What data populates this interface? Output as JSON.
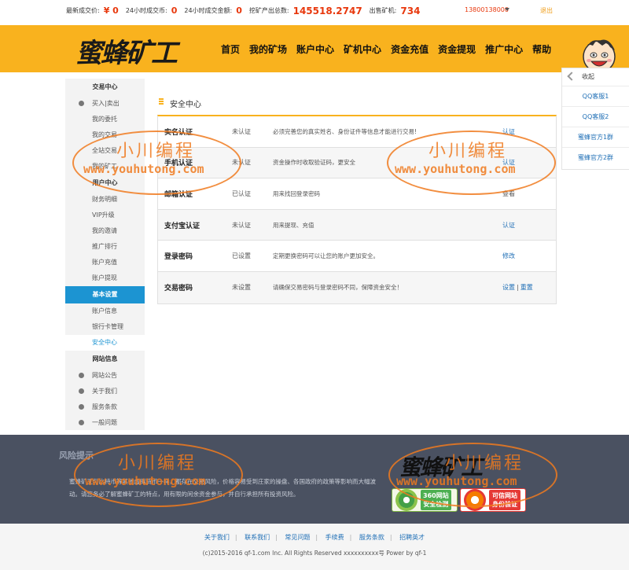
{
  "topbar": {
    "latest_price_label": "最新成交价:",
    "latest_price_value": "¥ 0",
    "vol24_label": "24小时成交币:",
    "vol24_value": "0",
    "amount24_label": "24小时成交金额:",
    "amount24_value": "0",
    "mined_label": "挖矿产出总数:",
    "mined_value": "145518.2747",
    "miners_label": "出售矿机:",
    "miners_value": "734",
    "user": "13800138000",
    "logout": "退出"
  },
  "header": {
    "logo_text": "蜜蜂矿工",
    "nav": [
      "首页",
      "我的矿场",
      "账户中心",
      "矿机中心",
      "资金充值",
      "资金提现",
      "推广中心",
      "帮助"
    ]
  },
  "float_panel": {
    "collapse": "收起",
    "items": [
      "QQ客服1",
      "QQ客服2",
      "蜜蜂官方1群",
      "蜜蜂官方2群"
    ]
  },
  "sidebar": {
    "trade_title": "交易中心",
    "trade_items": [
      "买入|卖出",
      "我的委托",
      "我的交易",
      "全站交易",
      "我的矿工"
    ],
    "user_title": "用户中心",
    "user_items": [
      "财务明细",
      "VIP升级",
      "我的邀请",
      "推广排行",
      "账户充值",
      "账户提现"
    ],
    "basic_title": "基本设置",
    "basic_items": [
      "账户信息",
      "银行卡管理",
      "安全中心"
    ],
    "site_title": "网站信息",
    "site_items": [
      "网站公告",
      "关于我们",
      "服务条款",
      "一般问题"
    ]
  },
  "main": {
    "title": "安全中心",
    "rows": [
      {
        "name": "实名认证",
        "status": "未认证",
        "desc": "必须完善您的真实姓名、身份证件等信息才能进行交易!",
        "action": "认证",
        "action2": ""
      },
      {
        "name": "手机认证",
        "status": "未认证",
        "desc": "资金操作时收取验证码，更安全",
        "action": "认证",
        "action2": ""
      },
      {
        "name": "邮箱认证",
        "status": "已认证",
        "desc": "用来找回登录密码",
        "action": "查看",
        "action2": ""
      },
      {
        "name": "支付宝认证",
        "status": "未认证",
        "desc": "用来提现、充值",
        "action": "认证",
        "action2": ""
      },
      {
        "name": "登录密码",
        "status": "已设置",
        "desc": "定期更换密码可以让您的账户更加安全。",
        "action": "修改",
        "action2": ""
      },
      {
        "name": "交易密码",
        "status": "未设置",
        "desc": "请确保交易密码与登录密码不同，保障资金安全！",
        "action": "设置",
        "action2": "重置"
      }
    ]
  },
  "watermark": {
    "cn": "小川编程",
    "url": "www.youhutong.com"
  },
  "footer": {
    "risk_title": "风险提示",
    "risk_text": "蜜蜂矿工与比特币等其他虚拟货币一样，都存在交易风险，价格容易受到庄家的操盘、各国政府的政策等影响而大幅波动。请您务必了解蜜蜂矿工的特点，用有限的闲余资金参与，并自行承担所有投资风险。",
    "logo_text": "蜜蜂矿工",
    "badge1_line1": "360网站",
    "badge1_line2": "安全检测",
    "badge2_line1": "可信网站",
    "badge2_line2": "身份验证",
    "links": [
      "关于我们",
      "联系我们",
      "常见问题",
      "手续费",
      "服务条款",
      "招聘英才"
    ],
    "copyright": "(c)2015-2016 qf-1.com Inc. All Rights Reserved xxxxxxxxxx号 Power by qf-1"
  }
}
